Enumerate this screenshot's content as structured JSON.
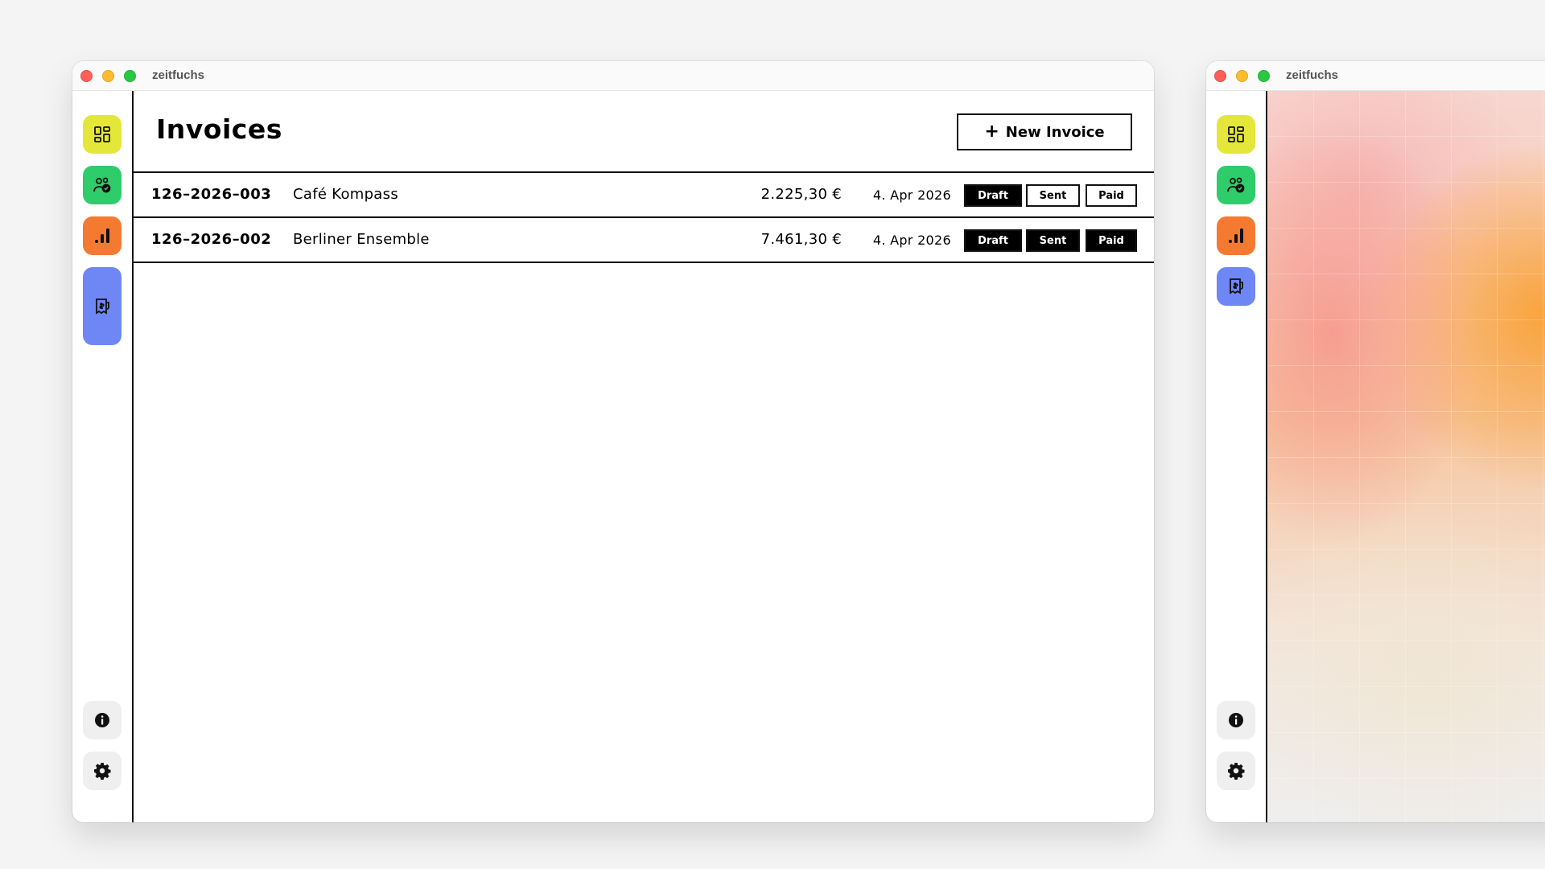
{
  "main_window": {
    "title": "zeitfuchs",
    "sidebar": {
      "items": [
        {
          "icon": "dashboard-icon",
          "color": "#e4e63a"
        },
        {
          "icon": "clients-icon",
          "color": "#2ecc6a"
        },
        {
          "icon": "stats-icon",
          "color": "#f47a32"
        },
        {
          "icon": "invoices-icon",
          "color": "#6f86f5",
          "active": true
        }
      ],
      "bottom": [
        {
          "icon": "info-icon"
        },
        {
          "icon": "gear-icon"
        }
      ]
    },
    "page_title": "Invoices",
    "new_invoice_plus": "+",
    "new_invoice_label": "New Invoice",
    "invoices": [
      {
        "number": "126–2026–003",
        "client": "Café Kompass",
        "amount": "2.225,30 €",
        "date": "4. Apr 2026",
        "status": {
          "draft": "Draft",
          "sent": "Sent",
          "paid": "Paid"
        },
        "active": "draft"
      },
      {
        "number": "126–2026–002",
        "client": "Berliner Ensemble",
        "amount": "7.461,30 €",
        "date": "4. Apr 2026",
        "status": {
          "draft": "Draft",
          "sent": "Sent",
          "paid": "Paid"
        },
        "active": "all"
      }
    ]
  },
  "second_window": {
    "title": "zeitfuchs"
  },
  "colors": {
    "background": "#f4f4f4",
    "dashboard": "#e4e63a",
    "clients": "#2ecc6a",
    "stats": "#f47a32",
    "invoices": "#6f86f5",
    "neutral_button": "#efefef"
  }
}
